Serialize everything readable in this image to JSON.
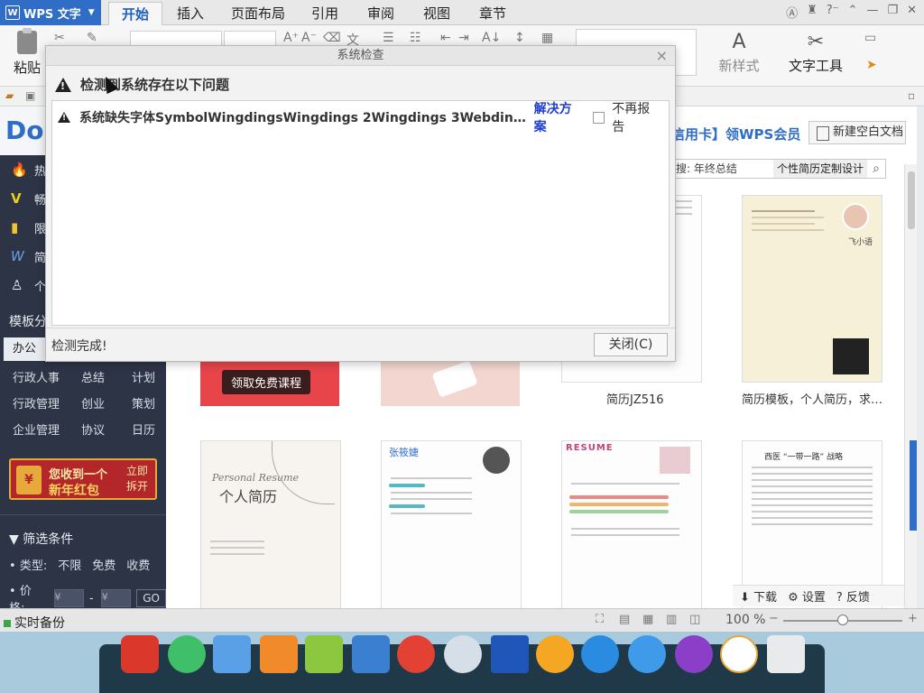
{
  "titlebar": {
    "app_name": "WPS 文字",
    "tabs": [
      {
        "label": "开始",
        "active": true
      },
      {
        "label": "插入"
      },
      {
        "label": "页面布局"
      },
      {
        "label": "引用"
      },
      {
        "label": "审阅"
      },
      {
        "label": "视图"
      },
      {
        "label": "章节"
      }
    ]
  },
  "toolbar": {
    "paste_label": "粘贴",
    "new_style_label": "新样式",
    "text_tool_label": "文字工具"
  },
  "sidebar": {
    "nav": [
      {
        "label": "热门",
        "icon": "flame-icon"
      },
      {
        "label": "畅销",
        "icon": "v-icon"
      },
      {
        "label": "限免",
        "icon": "tag-icon"
      },
      {
        "label": "简历",
        "icon": "w-icon"
      },
      {
        "label": "个人",
        "icon": "person-icon"
      }
    ],
    "section_title": "模板分",
    "tabs": [
      "办公",
      "",
      "",
      ""
    ],
    "categories": [
      "行政人事",
      "总结",
      "计划",
      "行政管理",
      "创业",
      "策划",
      "企业管理",
      "协议",
      "日历"
    ],
    "redpack": {
      "line1": "您收到一个",
      "line2": "新年红包",
      "action": "立即\n拆开"
    },
    "filter": {
      "title": "筛选条件",
      "type_label": "类型:",
      "type_options": [
        "不限",
        "免费",
        "收费"
      ],
      "price_label": "价格:",
      "price_from_placeholder": "¥",
      "price_to_placeholder": "¥",
      "go_label": "GO"
    }
  },
  "main": {
    "vip_text": "信用卡】领WPS会员",
    "new_doc_label": "新建空白文档",
    "search_hint": "搜: 年终总结",
    "search_keyword": "个性简历定制设计",
    "red_card_button": "领取免费课程",
    "captions": [
      "简历JZ516",
      "简历模板，个人简历，求职…"
    ],
    "resume_script_title": "Personal Resume",
    "resume_cn_title": "个人简历",
    "resume_name_cn": "张筱婕",
    "resume_banner": "RESUME",
    "doc_title": "西医 “一带一路” 战略",
    "profile_name": "飞小语",
    "bottom_actions": [
      {
        "label": "下载",
        "icon": "download-icon"
      },
      {
        "label": "设置",
        "icon": "gear-icon"
      },
      {
        "label": "反馈",
        "icon": "help-icon"
      }
    ]
  },
  "dialog": {
    "title": "系统检查",
    "heading": "检测到系统存在以下问题",
    "issue": "系统缺失字体SymbolWingdingsWingdings 2Wingdings 3WebdingsMT Ex…",
    "fix_link": "解决方案",
    "dont_report": "不再报告",
    "status": "检测完成!",
    "close_button": "关闭(C)"
  },
  "statusbar": {
    "backup_label": "实时备份",
    "zoom": "100 %"
  },
  "colors": {
    "accent_blue": "#2f6dc6",
    "sidebar_bg": "#2d3446",
    "link_blue": "#1f3fd0",
    "redpack_red": "#b3272b"
  }
}
